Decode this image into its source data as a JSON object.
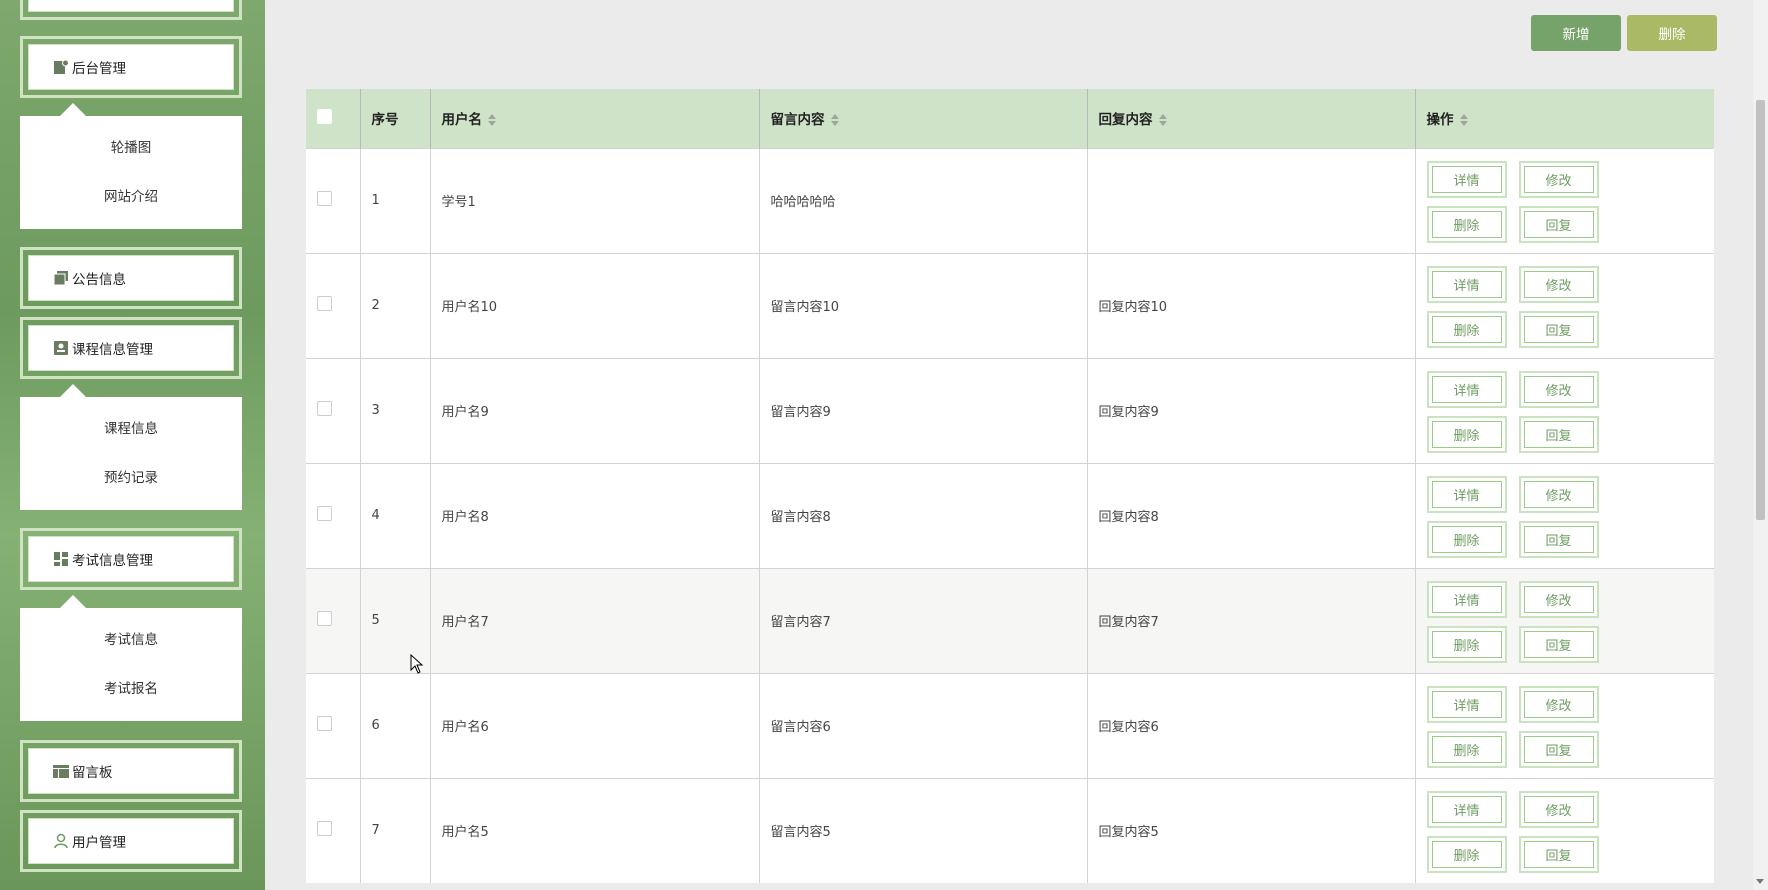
{
  "sidebar": {
    "menus": [
      {
        "label": "后台管理",
        "icon": "admin-icon",
        "sub": [
          "轮播图",
          "网站介绍"
        ]
      },
      {
        "label": "公告信息",
        "icon": "notice-icon",
        "sub": []
      },
      {
        "label": "课程信息管理",
        "icon": "course-icon",
        "sub": [
          "课程信息",
          "预约记录"
        ]
      },
      {
        "label": "考试信息管理",
        "icon": "exam-icon",
        "sub": [
          "考试信息",
          "考试报名"
        ]
      },
      {
        "label": "留言板",
        "icon": "message-board-icon",
        "sub": []
      },
      {
        "label": "用户管理",
        "icon": "user-icon",
        "sub": []
      }
    ]
  },
  "toolbar": {
    "add_label": "新增",
    "delete_label": "删除"
  },
  "table": {
    "headers": [
      "序号",
      "用户名",
      "留言内容",
      "回复内容",
      "操作"
    ],
    "row_actions": [
      "详情",
      "修改",
      "删除",
      "回复"
    ],
    "rows": [
      {
        "index": "1",
        "username": "学号1",
        "message": "哈哈哈哈哈",
        "reply": ""
      },
      {
        "index": "2",
        "username": "用户名10",
        "message": "留言内容10",
        "reply": "回复内容10"
      },
      {
        "index": "3",
        "username": "用户名9",
        "message": "留言内容9",
        "reply": "回复内容9"
      },
      {
        "index": "4",
        "username": "用户名8",
        "message": "留言内容8",
        "reply": "回复内容8"
      },
      {
        "index": "5",
        "username": "用户名7",
        "message": "留言内容7",
        "reply": "回复内容7"
      },
      {
        "index": "6",
        "username": "用户名6",
        "message": "留言内容6",
        "reply": "回复内容6"
      },
      {
        "index": "7",
        "username": "用户名5",
        "message": "留言内容5",
        "reply": "回复内容5"
      }
    ]
  },
  "colors": {
    "accent": "#76a36a",
    "delete": "#aab966",
    "header_bg": "#cfe3c8",
    "sidebar": "#7ea86d"
  }
}
